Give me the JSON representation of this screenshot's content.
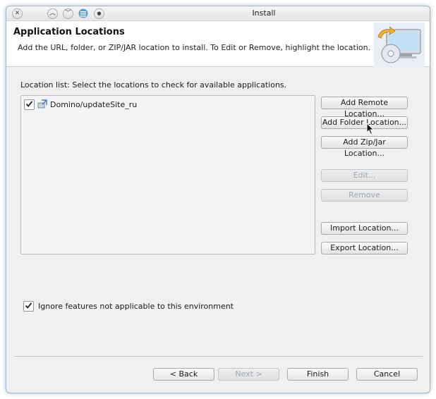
{
  "window": {
    "title": "Install",
    "buttons": [
      "close-icon",
      "chevron-up-icon",
      "chevron-down-icon",
      "app-icon",
      "pin-icon"
    ]
  },
  "header": {
    "title": "Application Locations",
    "description": "Add the URL, folder, or ZIP/JAR location to install. To Edit or Remove, highlight the location."
  },
  "location_list": {
    "label": "Location list: Select the locations to check for available applications.",
    "items": [
      {
        "label": "Domino/updateSite_ru",
        "checked": true
      }
    ]
  },
  "side_buttons": {
    "add_remote": "Add Remote Location...",
    "add_folder": "Add Folder Location...",
    "add_zip": "Add Zip/Jar Location...",
    "edit": "Edit...",
    "remove": "Remove",
    "import": "Import Location...",
    "export": "Export Location..."
  },
  "ignore_checkbox": {
    "label": "Ignore features not applicable to this environment",
    "checked": true
  },
  "footer": {
    "back": "< Back",
    "next": "Next >",
    "finish": "Finish",
    "cancel": "Cancel"
  },
  "colors": {
    "window_border": "#9fb4c6",
    "dialog_bg": "#eff0f1",
    "header_bg": "#ffffff",
    "disabled_text": "#a4a8ac"
  }
}
